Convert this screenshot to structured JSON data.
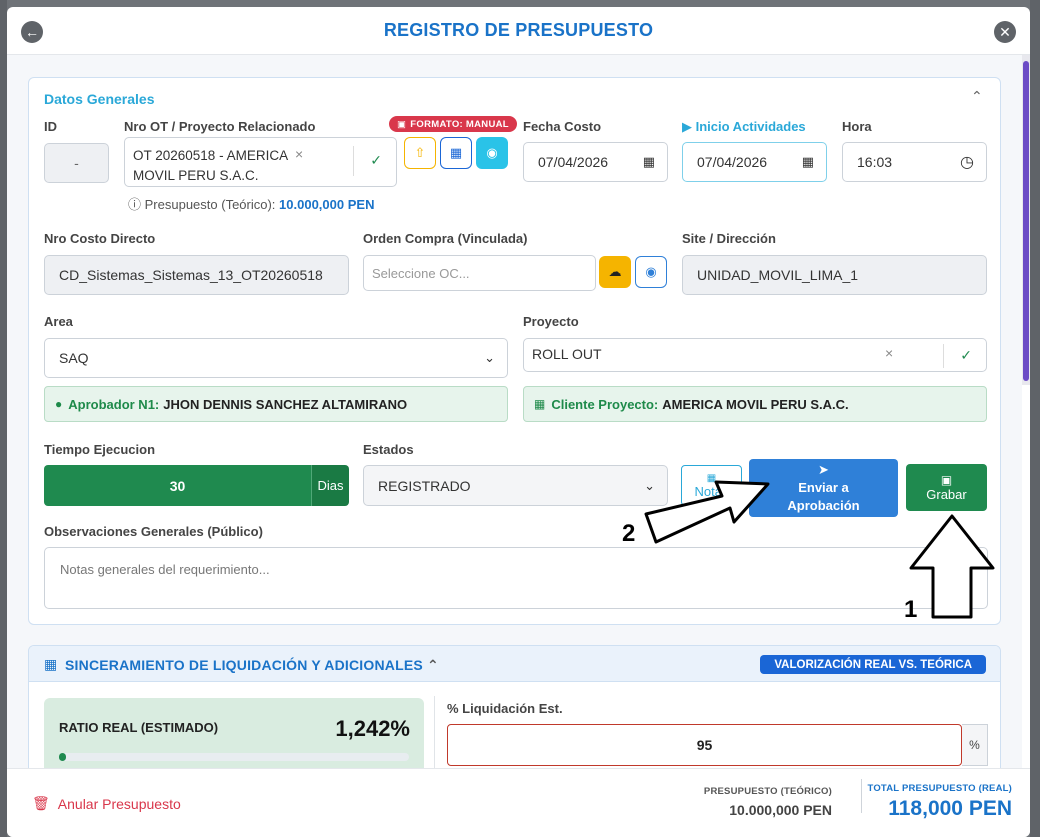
{
  "modal": {
    "title": "REGISTRO DE PRESUPUESTO"
  },
  "datos_generales": {
    "title": "Datos Generales",
    "id": {
      "label": "ID",
      "value": "-"
    },
    "nro_ot": {
      "label": "Nro OT / Proyecto Relacionado",
      "value": "OT 20260518 - AMERICA MOVIL PERU S.A.C.",
      "format_badge": "FORMATO: MANUAL"
    },
    "presupuesto_teorico": {
      "label": "Presupuesto (Teórico):",
      "value": "10.000,000 PEN"
    },
    "fecha_costo": {
      "label": "Fecha Costo",
      "value": "07/04/2026"
    },
    "inicio_actividades": {
      "label": "Inicio Actividades",
      "value": "07/04/2026"
    },
    "hora": {
      "label": "Hora",
      "value": "16:03"
    },
    "nro_costo_directo": {
      "label": "Nro Costo Directo",
      "value": "CD_Sistemas_Sistemas_13_OT20260518"
    },
    "orden_compra": {
      "label": "Orden Compra (Vinculada)",
      "placeholder": "Seleccione OC..."
    },
    "site": {
      "label": "Site / Dirección",
      "value": "UNIDAD_MOVIL_LIMA_1"
    },
    "area": {
      "label": "Area",
      "value": "SAQ"
    },
    "proyecto": {
      "label": "Proyecto",
      "value": "ROLL OUT"
    },
    "aprobador": {
      "key": "Aprobador N1:",
      "value": "JHON DENNIS SANCHEZ ALTAMIRANO"
    },
    "cliente": {
      "key": "Cliente Proyecto:",
      "value": "AMERICA MOVIL PERU S.A.C."
    },
    "tiempo": {
      "label": "Tiempo Ejecucion",
      "value": "30",
      "unit": "Dias"
    },
    "estados": {
      "label": "Estados",
      "value": "REGISTRADO"
    },
    "notas_label": "Notas",
    "enviar_label": "Enviar a Aprobación",
    "grabar_label": "Grabar",
    "observaciones": {
      "label": "Observaciones Generales (Público)",
      "placeholder": "Notas generales del requerimiento..."
    }
  },
  "sinceramiento": {
    "title": "SINCERAMIENTO DE LIQUIDACIÓN Y ADICIONALES",
    "badge": "VALORIZACIÓN REAL VS. TEÓRICA",
    "ratio": {
      "label": "RATIO REAL (ESTIMADO)",
      "value": "1,242%",
      "progress_pct": 2
    },
    "liquidacion": {
      "label": "% Liquidación Est.",
      "value": "95",
      "unit": "%"
    }
  },
  "footer": {
    "anular": "Anular Presupuesto",
    "teorico": {
      "label": "PRESUPUESTO (TEÓRICO)",
      "value": "10.000,000 PEN"
    },
    "real": {
      "label": "TOTAL PRESUPUESTO (REAL)",
      "value": "118,000 PEN"
    }
  },
  "annotations": {
    "one": "1",
    "two": "2"
  },
  "colors": {
    "primary": "#1a73c8",
    "success": "#1f8a4f",
    "danger": "#d9374b",
    "info": "#2aa8d8",
    "warning": "#f5b400"
  }
}
